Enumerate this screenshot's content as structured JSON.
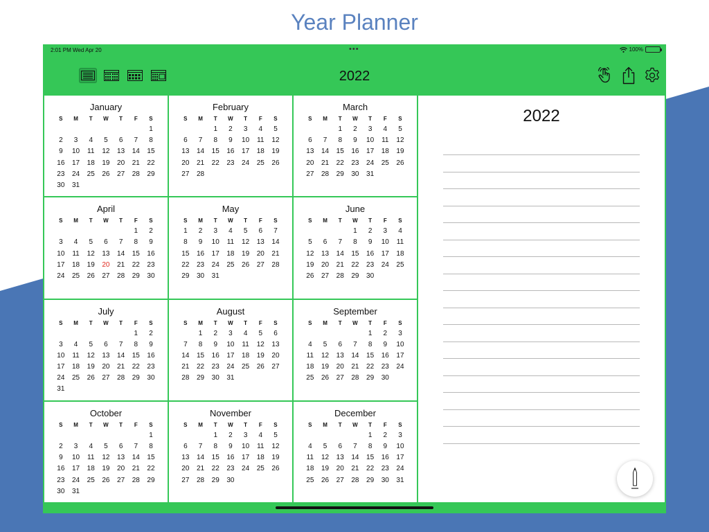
{
  "page_title": "Year Planner",
  "colors": {
    "accent_green": "#35c757",
    "background_blue": "#4a76b5",
    "today_red": "#e0281e"
  },
  "status_bar": {
    "time": "2:01 PM  Wed Apr 20",
    "battery": "100%",
    "dots": "•••"
  },
  "toolbar": {
    "year": "2022",
    "view_buttons": [
      "list-view-icon",
      "grid-3x4-view-icon",
      "grid-4x3-view-icon",
      "grid-2x6-view-icon"
    ],
    "right_icons": [
      "tap-gesture-icon",
      "share-icon",
      "gear-icon"
    ]
  },
  "weekday_headers": [
    "S",
    "M",
    "T",
    "W",
    "T",
    "F",
    "S"
  ],
  "months": [
    {
      "name": "January",
      "start": 6,
      "days": 31
    },
    {
      "name": "February",
      "start": 2,
      "days": 28
    },
    {
      "name": "March",
      "start": 2,
      "days": 31
    },
    {
      "name": "April",
      "start": 5,
      "days": 30,
      "today": 20
    },
    {
      "name": "May",
      "start": 0,
      "days": 31
    },
    {
      "name": "June",
      "start": 3,
      "days": 30
    },
    {
      "name": "July",
      "start": 5,
      "days": 31
    },
    {
      "name": "August",
      "start": 1,
      "days": 31
    },
    {
      "name": "September",
      "start": 4,
      "days": 30
    },
    {
      "name": "October",
      "start": 6,
      "days": 31
    },
    {
      "name": "November",
      "start": 2,
      "days": 30
    },
    {
      "name": "December",
      "start": 4,
      "days": 31
    }
  ],
  "notes": {
    "year": "2022",
    "line_count": 18
  },
  "pencil": {
    "icon": "pencil-icon"
  }
}
